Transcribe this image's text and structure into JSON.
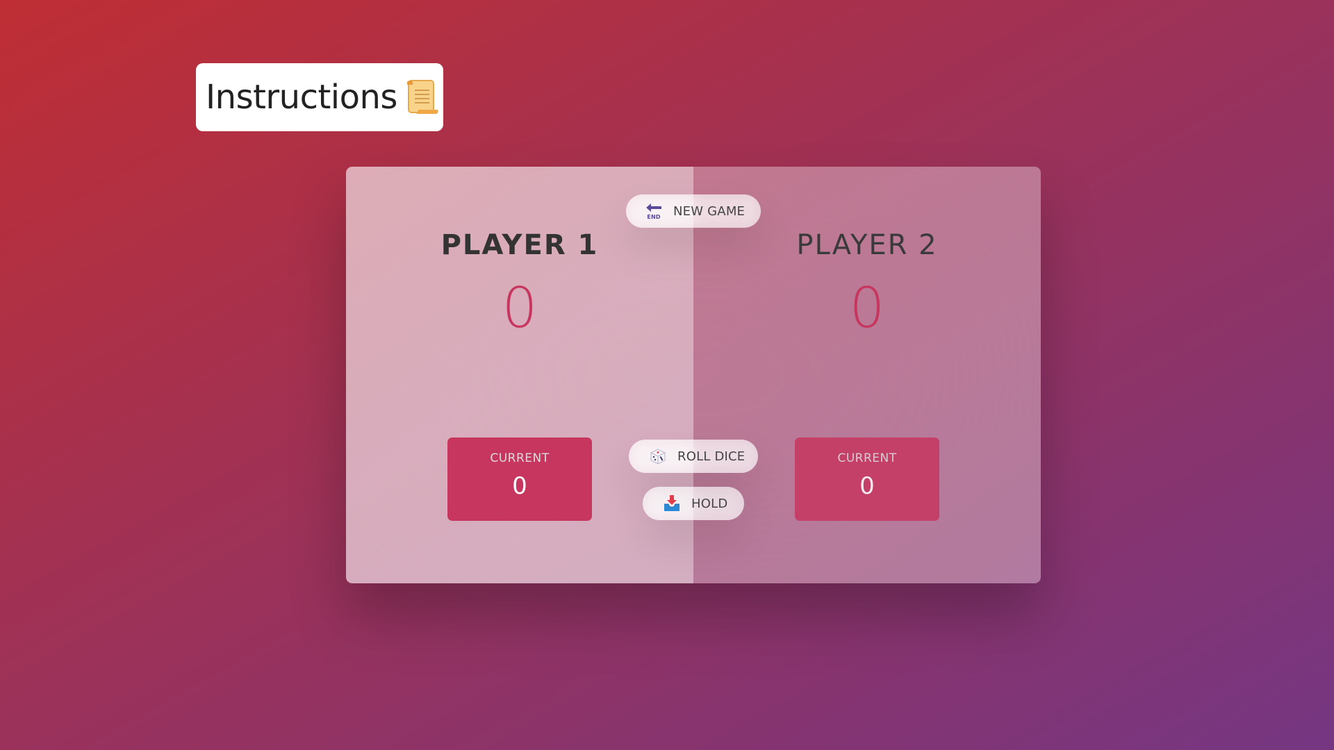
{
  "instructions": {
    "label": "Instructions",
    "icon": "scroll-icon"
  },
  "players": [
    {
      "name": "PLAYER 1",
      "score": "0",
      "current_label": "CURRENT",
      "current_score": "0",
      "active": true
    },
    {
      "name": "PLAYER 2",
      "score": "0",
      "current_label": "CURRENT",
      "current_score": "0",
      "active": false
    }
  ],
  "buttons": {
    "new_game": {
      "label": "NEW GAME",
      "icon": "end-arrow-icon"
    },
    "roll_dice": {
      "label": "ROLL DICE",
      "icon": "dice-icon"
    },
    "hold": {
      "label": "HOLD",
      "icon": "inbox-tray-icon"
    }
  },
  "colors": {
    "accent": "#c7365f",
    "background_start": "#bf2e34",
    "background_end": "#753682"
  }
}
